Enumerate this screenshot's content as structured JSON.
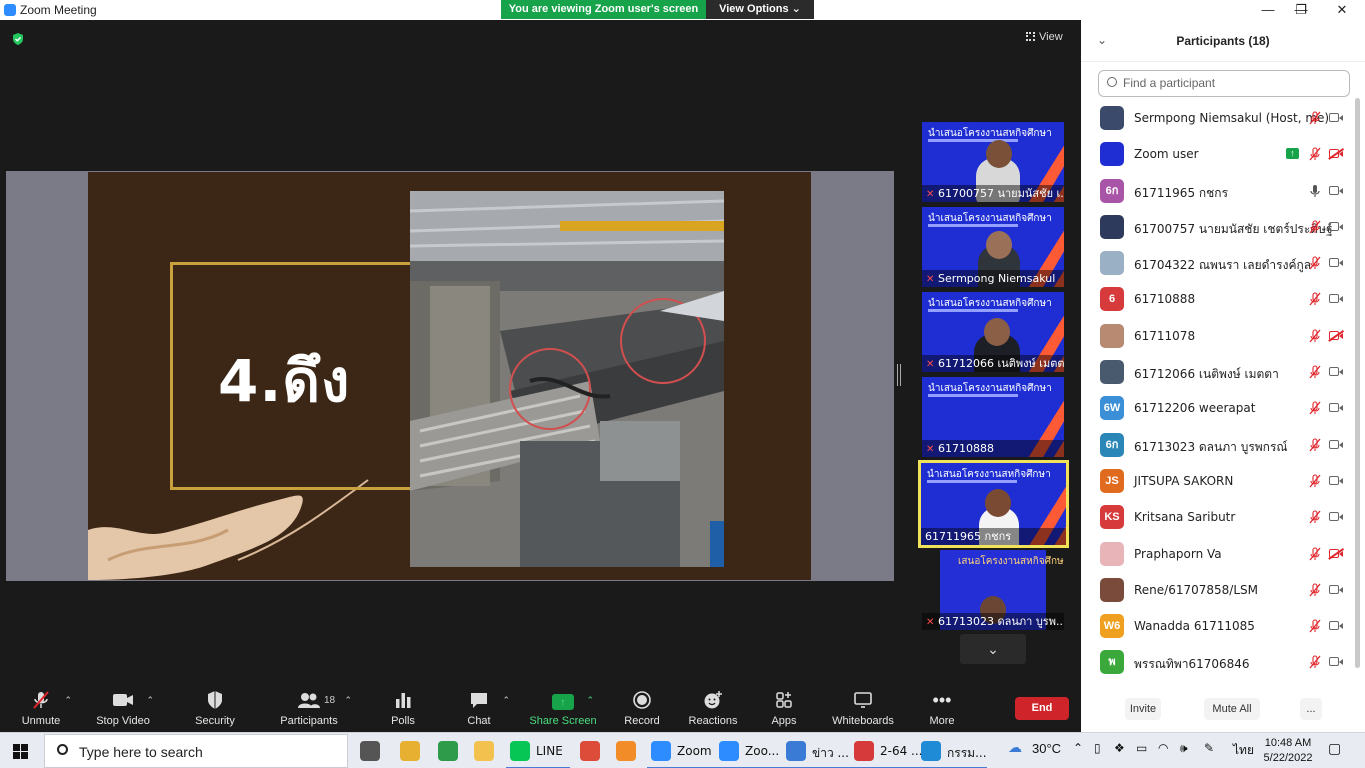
{
  "window": {
    "title": "Zoom Meeting",
    "banner": "You are viewing Zoom user's screen",
    "view_options": "View Options",
    "minimize": "—",
    "maximize": "❐",
    "close": "✕"
  },
  "meeting": {
    "view_label": "View",
    "slide_text": "4.ดึง",
    "thumbnails": [
      {
        "header": "นำเสนอโครงงานสหกิจศึกษา",
        "label": "61700757 นายมนัสชัย เ...",
        "muted": true
      },
      {
        "header": "นำเสนอโครงงานสหกิจศึกษา",
        "label": "Sermpong Niemsakul",
        "muted": true
      },
      {
        "header": "นำเสนอโครงงานสหกิจศึกษา",
        "label": "61712066 เนติพงษ์ เมตตา",
        "muted": true
      },
      {
        "header": "นำเสนอโครงงานสหกิจศึกษา",
        "label": "61710888",
        "muted": true
      },
      {
        "header": "นำเสนอโครงงานสหกิจศึกษา",
        "label": "61711965 กชกร",
        "muted": false
      },
      {
        "header": "เสนอโครงงานสหกิจศึกษา",
        "label": "61713023 ดลนภา บูรพ...",
        "muted": true
      }
    ]
  },
  "toolbar": {
    "unmute": "Unmute",
    "stop_video": "Stop Video",
    "security": "Security",
    "participants": "Participants",
    "participants_count": "18",
    "polls": "Polls",
    "chat": "Chat",
    "share_screen": "Share Screen",
    "record": "Record",
    "reactions": "Reactions",
    "apps": "Apps",
    "whiteboards": "Whiteboards",
    "more": "More",
    "end": "End"
  },
  "panel": {
    "title": "Participants (18)",
    "search_placeholder": "Find a participant",
    "invite": "Invite",
    "mute_all": "Mute All",
    "more": "...",
    "participants": [
      {
        "avatar": "",
        "avatar_color": "#3b4a6b",
        "name": "Sermpong Niemsakul (Host, me)",
        "mic": "off",
        "cam": "on"
      },
      {
        "avatar": "",
        "avatar_color": "#1f2ed3",
        "name": "Zoom user",
        "mic": "off",
        "cam": "off",
        "sharing": true
      },
      {
        "avatar": "6ก",
        "avatar_color": "#a855a8",
        "name": "61711965 กชกร",
        "mic": "on",
        "cam": "on"
      },
      {
        "avatar": "",
        "avatar_color": "#2d3a5c",
        "name": "61700757 นายมนัสชัย เชตร์ประดิษฐ์",
        "mic": "off",
        "cam": "on"
      },
      {
        "avatar": "",
        "avatar_color": "#9ab0c4",
        "name": "61704322 ณพนรา เลยดำรงค์กูล",
        "mic": "off",
        "cam": "on"
      },
      {
        "avatar": "6",
        "avatar_color": "#d63a3a",
        "name": "61710888",
        "mic": "off",
        "cam": "on"
      },
      {
        "avatar": "",
        "avatar_color": "#b98a72",
        "name": "61711078",
        "mic": "off",
        "cam": "off"
      },
      {
        "avatar": "",
        "avatar_color": "#4a5a6e",
        "name": "61712066 เนติพงษ์ เมตตา",
        "mic": "off",
        "cam": "on"
      },
      {
        "avatar": "6W",
        "avatar_color": "#3a8fd6",
        "name": "61712206 weerapat",
        "mic": "off",
        "cam": "on"
      },
      {
        "avatar": "6ก",
        "avatar_color": "#2b86b8",
        "name": "61713023 ดลนภา บูรพกรณ์",
        "mic": "off",
        "cam": "on"
      },
      {
        "avatar": "JS",
        "avatar_color": "#e06a1e",
        "name": "JITSUPA  SAKORN",
        "mic": "off",
        "cam": "on"
      },
      {
        "avatar": "KS",
        "avatar_color": "#d63a3a",
        "name": "Kritsana Saributr",
        "mic": "off",
        "cam": "on"
      },
      {
        "avatar": "",
        "avatar_color": "#e8b4b8",
        "name": "Praphaporn Va",
        "mic": "off",
        "cam": "off"
      },
      {
        "avatar": "",
        "avatar_color": "#7a4b3a",
        "name": "Rene/61707858/LSM",
        "mic": "off",
        "cam": "on"
      },
      {
        "avatar": "W6",
        "avatar_color": "#f0a020",
        "name": "Wanadda 61711085",
        "mic": "off",
        "cam": "on"
      },
      {
        "avatar": "พ",
        "avatar_color": "#3aa83a",
        "name": "พรรณทิพา61706846",
        "mic": "off",
        "cam": "on"
      }
    ]
  },
  "taskbar": {
    "search_placeholder": "Type here to search",
    "apps": [
      {
        "name": "task-view",
        "label": "",
        "color": "#555"
      },
      {
        "name": "app-bird",
        "label": "",
        "color": "#e8b030"
      },
      {
        "name": "app-c",
        "label": "",
        "color": "#2e9b4a"
      },
      {
        "name": "file-explorer",
        "label": "",
        "color": "#f2c14e"
      },
      {
        "name": "line",
        "label": "LINE",
        "color": "#06c755"
      },
      {
        "name": "chrome",
        "label": "",
        "color": "#dd4b39"
      },
      {
        "name": "app-i",
        "label": "",
        "color": "#f28c28"
      },
      {
        "name": "zoom-1",
        "label": "Zoom",
        "color": "#2d8cff"
      },
      {
        "name": "zoom-2",
        "label": "Zoo...",
        "color": "#2d8cff"
      },
      {
        "name": "ie-news",
        "label": "ข่าว ...",
        "color": "#3a7bd5"
      },
      {
        "name": "pdf",
        "label": "2-64 ...",
        "color": "#d63a3a"
      },
      {
        "name": "edge",
        "label": "กรรม...",
        "color": "#1f8ad6"
      }
    ],
    "weather": "30°C",
    "lang": "ไทย",
    "time": "10:48 AM",
    "date": "5/22/2022"
  }
}
